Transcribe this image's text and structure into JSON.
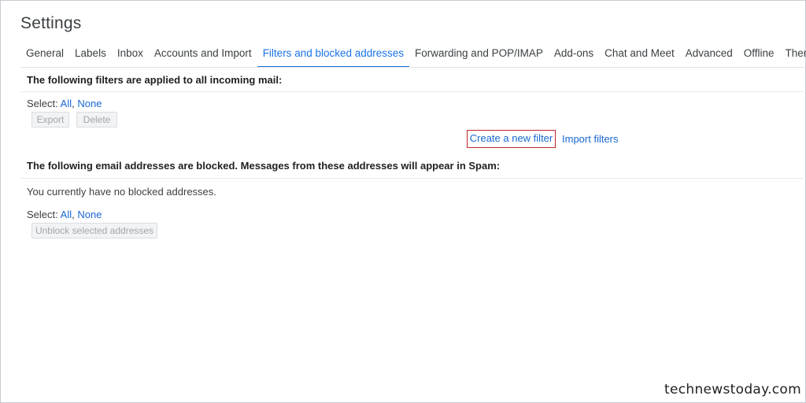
{
  "page": {
    "title": "Settings"
  },
  "tabs": [
    {
      "label": "General"
    },
    {
      "label": "Labels"
    },
    {
      "label": "Inbox"
    },
    {
      "label": "Accounts and Import"
    },
    {
      "label": "Filters and blocked addresses",
      "active": true
    },
    {
      "label": "Forwarding and POP/IMAP"
    },
    {
      "label": "Add-ons"
    },
    {
      "label": "Chat and Meet"
    },
    {
      "label": "Advanced"
    },
    {
      "label": "Offline"
    },
    {
      "label": "Themes"
    }
  ],
  "filters": {
    "heading": "The following filters are applied to all incoming mail:",
    "select_label": "Select:",
    "select_all": "All",
    "select_none": "None",
    "export_label": "Export",
    "delete_label": "Delete",
    "create_filter_label": "Create a new filter",
    "import_filters_label": "Import filters"
  },
  "blocked": {
    "heading": "The following email addresses are blocked. Messages from these addresses will appear in Spam:",
    "empty_text": "You currently have no blocked addresses.",
    "select_label": "Select:",
    "select_all": "All",
    "select_none": "None",
    "unblock_label": "Unblock selected addresses"
  },
  "watermark": "technewstoday.com",
  "colors": {
    "accent": "#1a73e8",
    "link": "#1967d2",
    "highlight_box": "#c0272d"
  }
}
